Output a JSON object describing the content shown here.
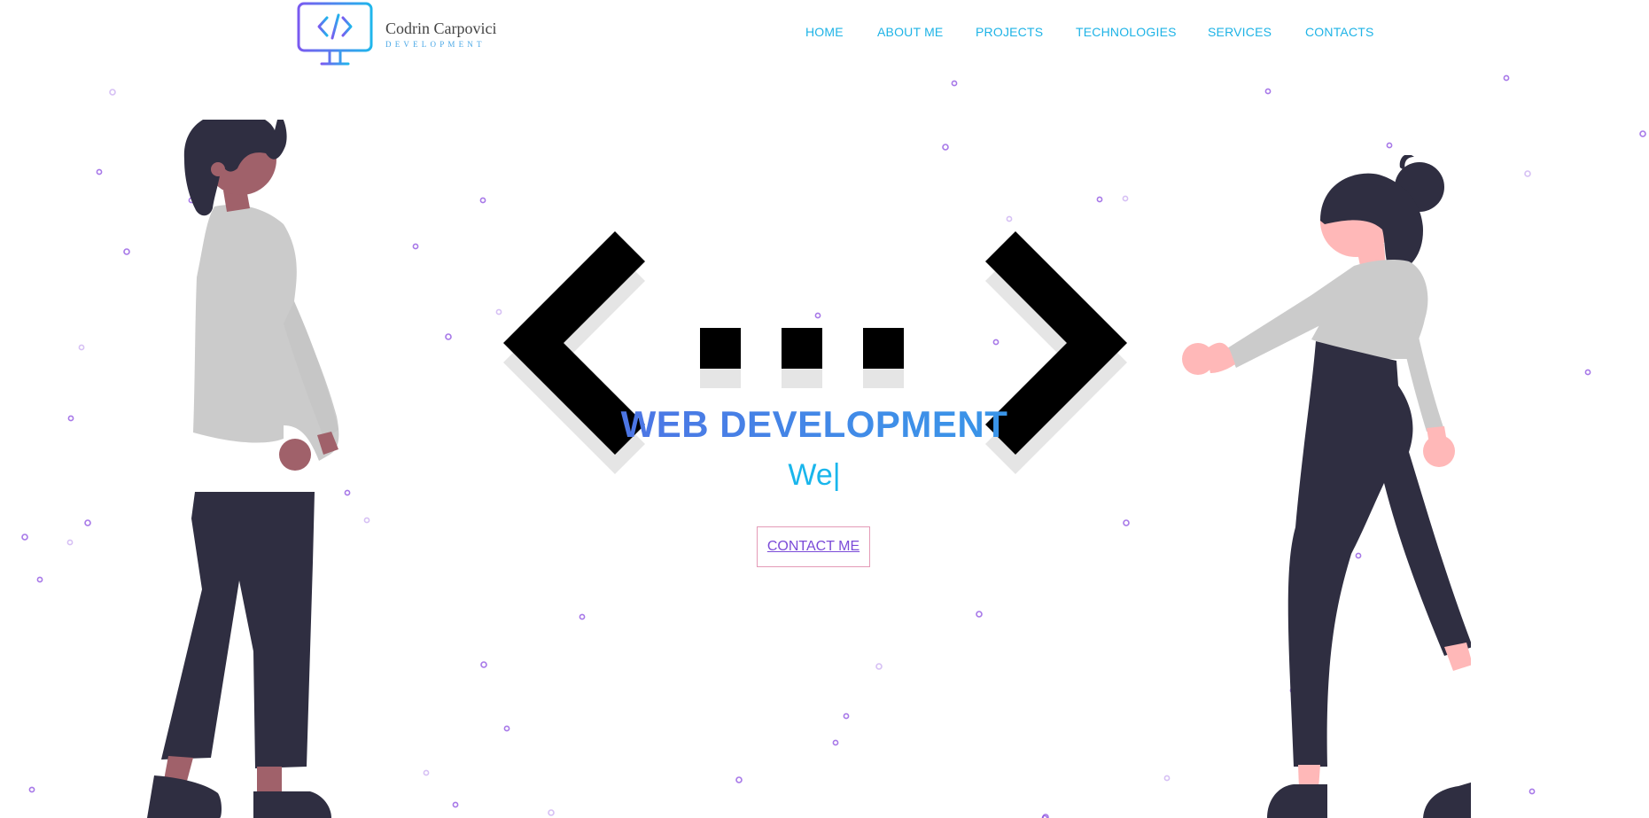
{
  "brand": {
    "name": "Codrin Carpovici",
    "subtitle": "DEVELOPMENT",
    "logo_icon": "code-monitor-icon"
  },
  "nav": {
    "items": [
      {
        "label": "HOME"
      },
      {
        "label": "ABOUT ME"
      },
      {
        "label": "PROJECTS"
      },
      {
        "label": "TECHNOLOGIES"
      },
      {
        "label": "SERVICES"
      },
      {
        "label": "CONTACTS"
      }
    ]
  },
  "hero": {
    "title": "WEB DEVELOPMENT",
    "typed_text": "We|",
    "cta_label": "CONTACT ME",
    "symbol": "<...>"
  },
  "colors": {
    "accent_blue": "#1eb3e6",
    "accent_purple": "#6c3bdc",
    "cta_border": "#e49bb7",
    "figure_dark": "#2f2e41",
    "figure_shirt": "#cbcbcb",
    "particle": "#8a4be0"
  }
}
